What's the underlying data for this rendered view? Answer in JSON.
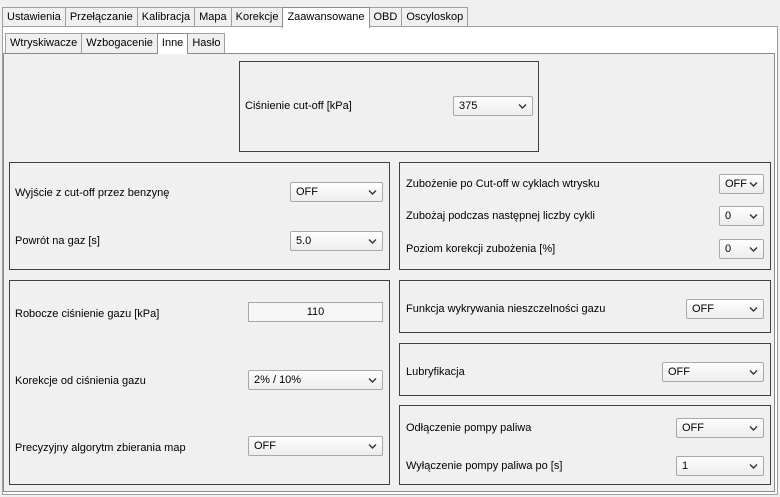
{
  "main_tabs": [
    "Ustawienia",
    "Przełączanie",
    "Kalibracja",
    "Mapa",
    "Korekcje",
    "Zaawansowane",
    "OBD",
    "Oscyloskop"
  ],
  "sub_tabs": [
    "Wtryskiwacze",
    "Wzbogacenie",
    "Inne",
    "Hasło"
  ],
  "cutoff": {
    "label": "Ciśnienie cut-off  [kPa]",
    "value": "375"
  },
  "exit_group": {
    "exit_label": "Wyjście z cut-off przez benzynę",
    "exit_value": "OFF",
    "return_label": "Powrót na gaz [s]",
    "return_value": "5.0"
  },
  "lean_group": {
    "lean_cutoff_label": "Zubożenie po Cut-off w cyklach wtrysku",
    "lean_cutoff_value": "OFF",
    "lean_cycles_label": "Zubożaj podczas następnej liczby cykli",
    "lean_cycles_value": "0",
    "lean_level_label": "Poziom korekcji zubożenia [%]",
    "lean_level_value": "0"
  },
  "pressure_group": {
    "working_label": "Robocze ciśnienie gazu  [kPa]",
    "working_value": "110",
    "correction_label": "Korekcje od ciśnienia gazu",
    "correction_value": "2% / 10%",
    "precise_label": "Precyzyjny algorytm zbierania map",
    "precise_value": "OFF"
  },
  "leak": {
    "label": "Funkcja wykrywania nieszczelności gazu",
    "value": "OFF"
  },
  "lube": {
    "label": "Lubryfikacja",
    "value": "OFF"
  },
  "pump_group": {
    "disconnect_label": "Odłączenie pompy paliwa",
    "disconnect_value": "OFF",
    "shutoff_label": "Wyłączenie pompy paliwa po [s]",
    "shutoff_value": "1"
  }
}
